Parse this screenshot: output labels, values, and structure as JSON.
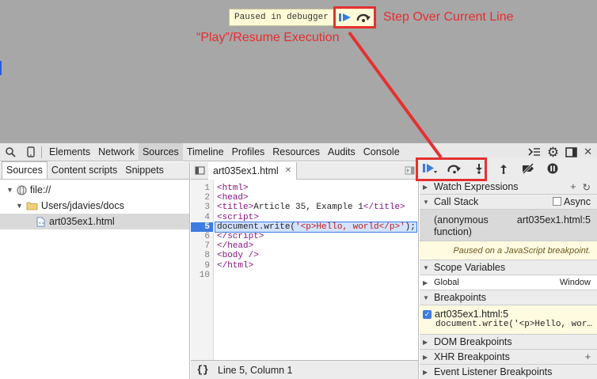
{
  "overlay": {
    "paused_text": "Paused in debugger",
    "annotation_step_over": "Step Over Current Line",
    "annotation_play": "“Play”/Resume Execution",
    "annotation_color": "#e62e2e"
  },
  "toolbar": {
    "tabs": [
      "Elements",
      "Network",
      "Sources",
      "Timeline",
      "Profiles",
      "Resources",
      "Audits",
      "Console"
    ],
    "active_tab": "Sources"
  },
  "navigator": {
    "tabs": [
      "Sources",
      "Content scripts",
      "Snippets"
    ],
    "tree": [
      "file://",
      "Users/jdavies/docs",
      "art035ex1.html"
    ]
  },
  "editor": {
    "file_tab": "art035ex1.html",
    "line_numbers": [
      "1",
      "2",
      "3",
      "4",
      "5",
      "6",
      "7",
      "8",
      "9",
      "10"
    ],
    "current_line": "5",
    "status": "Line 5, Column 1"
  },
  "debugger": {
    "watch_expressions": "Watch Expressions",
    "call_stack": "Call Stack",
    "async_label": "Async",
    "call_stack_function": "(anonymous function)",
    "call_stack_location": "art035ex1.html:5",
    "paused_message": "Paused on a JavaScript breakpoint.",
    "scope_variables": "Scope Variables",
    "scope_global": "Global",
    "scope_window": "Window",
    "breakpoints": "Breakpoints",
    "breakpoint_file": "art035ex1.html:5",
    "breakpoint_code": "document.write('<p>Hello, wor…",
    "dom_breakpoints": "DOM Breakpoints",
    "xhr_breakpoints": "XHR Breakpoints",
    "event_listener_breakpoints": "Event Listener Breakpoints"
  }
}
